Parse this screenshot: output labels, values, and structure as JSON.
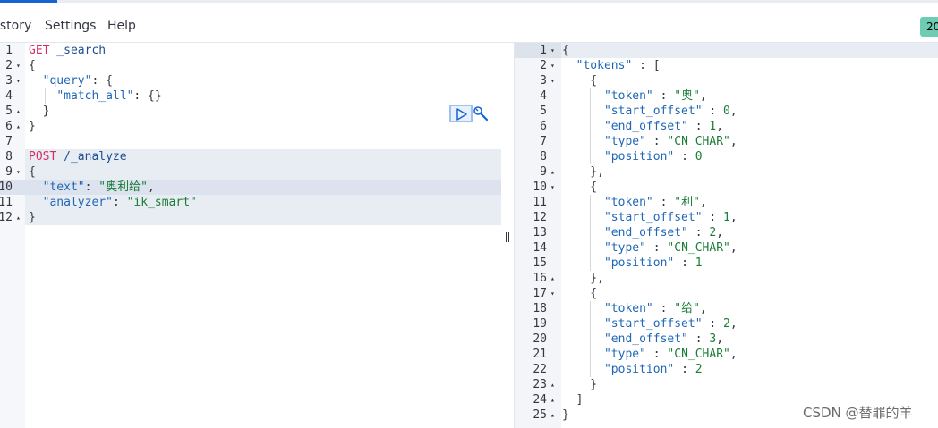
{
  "menu": {
    "history": "istory",
    "settings": "Settings",
    "help": "Help",
    "status": "20"
  },
  "request_editor": {
    "line_numbers": [
      "1",
      "2",
      "3",
      "4",
      "5",
      "6",
      "7",
      "8",
      "9",
      "10",
      "11",
      "12"
    ],
    "lines": [
      {
        "method": "GET",
        "path": " _search"
      },
      {
        "text": "{"
      },
      {
        "indent": "  ",
        "key": "\"query\"",
        "rest": ": {"
      },
      {
        "indent": "    ",
        "key": "\"match_all\"",
        "rest": ": {}"
      },
      {
        "indent": "  ",
        "rest": "}"
      },
      {
        "text": "}"
      },
      {
        "text": ""
      },
      {
        "method": "POST",
        "path": " /_analyze"
      },
      {
        "text": "{"
      },
      {
        "indent": "  ",
        "key": "\"text\"",
        "rest": ": ",
        "value": "\"奥利给\"",
        "tail": ","
      },
      {
        "indent": "  ",
        "key": "\"analyzer\"",
        "rest": ": ",
        "value": "\"ik_smart\""
      },
      {
        "text": "}"
      }
    ]
  },
  "response_viewer": {
    "line_numbers": [
      "1",
      "2",
      "3",
      "4",
      "5",
      "6",
      "7",
      "8",
      "9",
      "10",
      "11",
      "12",
      "13",
      "14",
      "15",
      "16",
      "17",
      "18",
      "19",
      "20",
      "21",
      "22",
      "23",
      "24",
      "25"
    ],
    "lines": [
      "{",
      "  \"tokens\" : [",
      "    {",
      "      \"token\" : \"奥\",",
      "      \"start_offset\" : 0,",
      "      \"end_offset\" : 1,",
      "      \"type\" : \"CN_CHAR\",",
      "      \"position\" : 0",
      "    },",
      "    {",
      "      \"token\" : \"利\",",
      "      \"start_offset\" : 1,",
      "      \"end_offset\" : 2,",
      "      \"type\" : \"CN_CHAR\",",
      "      \"position\" : 1",
      "    },",
      "    {",
      "      \"token\" : \"给\",",
      "      \"start_offset\" : 2,",
      "      \"end_offset\" : 3,",
      "      \"type\" : \"CN_CHAR\",",
      "      \"position\" : 2",
      "    }",
      "  ]",
      "}"
    ]
  },
  "watermark": "CSDN @替罪的羊",
  "colors": {
    "method": "#d72d61",
    "key": "#1f67b6",
    "string": "#1a7d36",
    "status_green": "#6dccb1",
    "accent_blue": "#1763d4"
  },
  "icons": {
    "run": "play-icon",
    "wrench": "wrench-icon",
    "splitter": "resize-handle-icon"
  }
}
